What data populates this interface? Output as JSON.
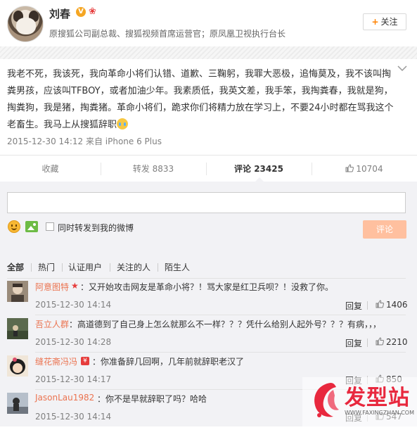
{
  "header": {
    "name": "刘春",
    "verified_mark": "V",
    "vip_mark": "❀",
    "bio": "原搜狐公司副总裁、搜狐视频首席运营官；原凤凰卫视执行台长",
    "follow_label": "关注",
    "follow_plus": "+"
  },
  "post": {
    "text": "我老不死，我该死，我向革命小将们认错、道歉、三鞠躬，我罪大恶极，追悔莫及，我不该叫掏粪男孩，应该叫TFBOY，或者加油少年。我素质低，我英文差，我手笨，我掏粪春，我就是狗，掏粪狗，我是猪，掏粪猪。革命小将们，跪求你们将精力放在学习上，不要24小时都在骂我这个老畜生。我马上从搜狐辞职",
    "meta": "2015-12-30 14:12 来自 iPhone 6 Plus",
    "chevron_icon": "chevron-down-icon"
  },
  "actions": {
    "favorite": "收藏",
    "repost": "转发 8833",
    "comment": "评论 23425",
    "like": "10704"
  },
  "composer": {
    "placeholder": "",
    "repost_option": "同时转发到我的微博",
    "submit": "评论"
  },
  "filters": [
    "全部",
    "热门",
    "认证用户",
    "关注的人",
    "陌生人"
  ],
  "comments": [
    {
      "user": "阿意图特",
      "text": "：又开始攻击网友是革命小将？！骂大家是红卫兵呗？！没救了你。",
      "time": "2015-12-30 14:14",
      "reply": "回复",
      "likes": "1406"
    },
    {
      "user": "吾立人群",
      "text": "：高道德到了自己身上怎么就那么不一样？？？凭什么给别人起外号？？？有病，，，",
      "time": "2015-12-30 14:28",
      "reply": "回复",
      "likes": "2210"
    },
    {
      "user": "缝花斋冯冯",
      "text": "：你准备辞几回啊，几年前就辞职老汉了",
      "time": "2015-12-30 14:17",
      "reply": "回复",
      "likes": "850"
    },
    {
      "user": "JasonLau1982",
      "text": "：你不是早就辞职了吗？哈哈",
      "time": "2015-12-30 14:14",
      "reply": "回复",
      "likes": "547"
    }
  ],
  "watermark": {
    "title": "发型站",
    "url": "WWW.FAXINGZHAN.COM"
  },
  "colors": {
    "accent": "#eb7350",
    "submit_disabled": "#ffc09f",
    "background": "#f2f2f5",
    "watermark_red": "#e8283e"
  }
}
